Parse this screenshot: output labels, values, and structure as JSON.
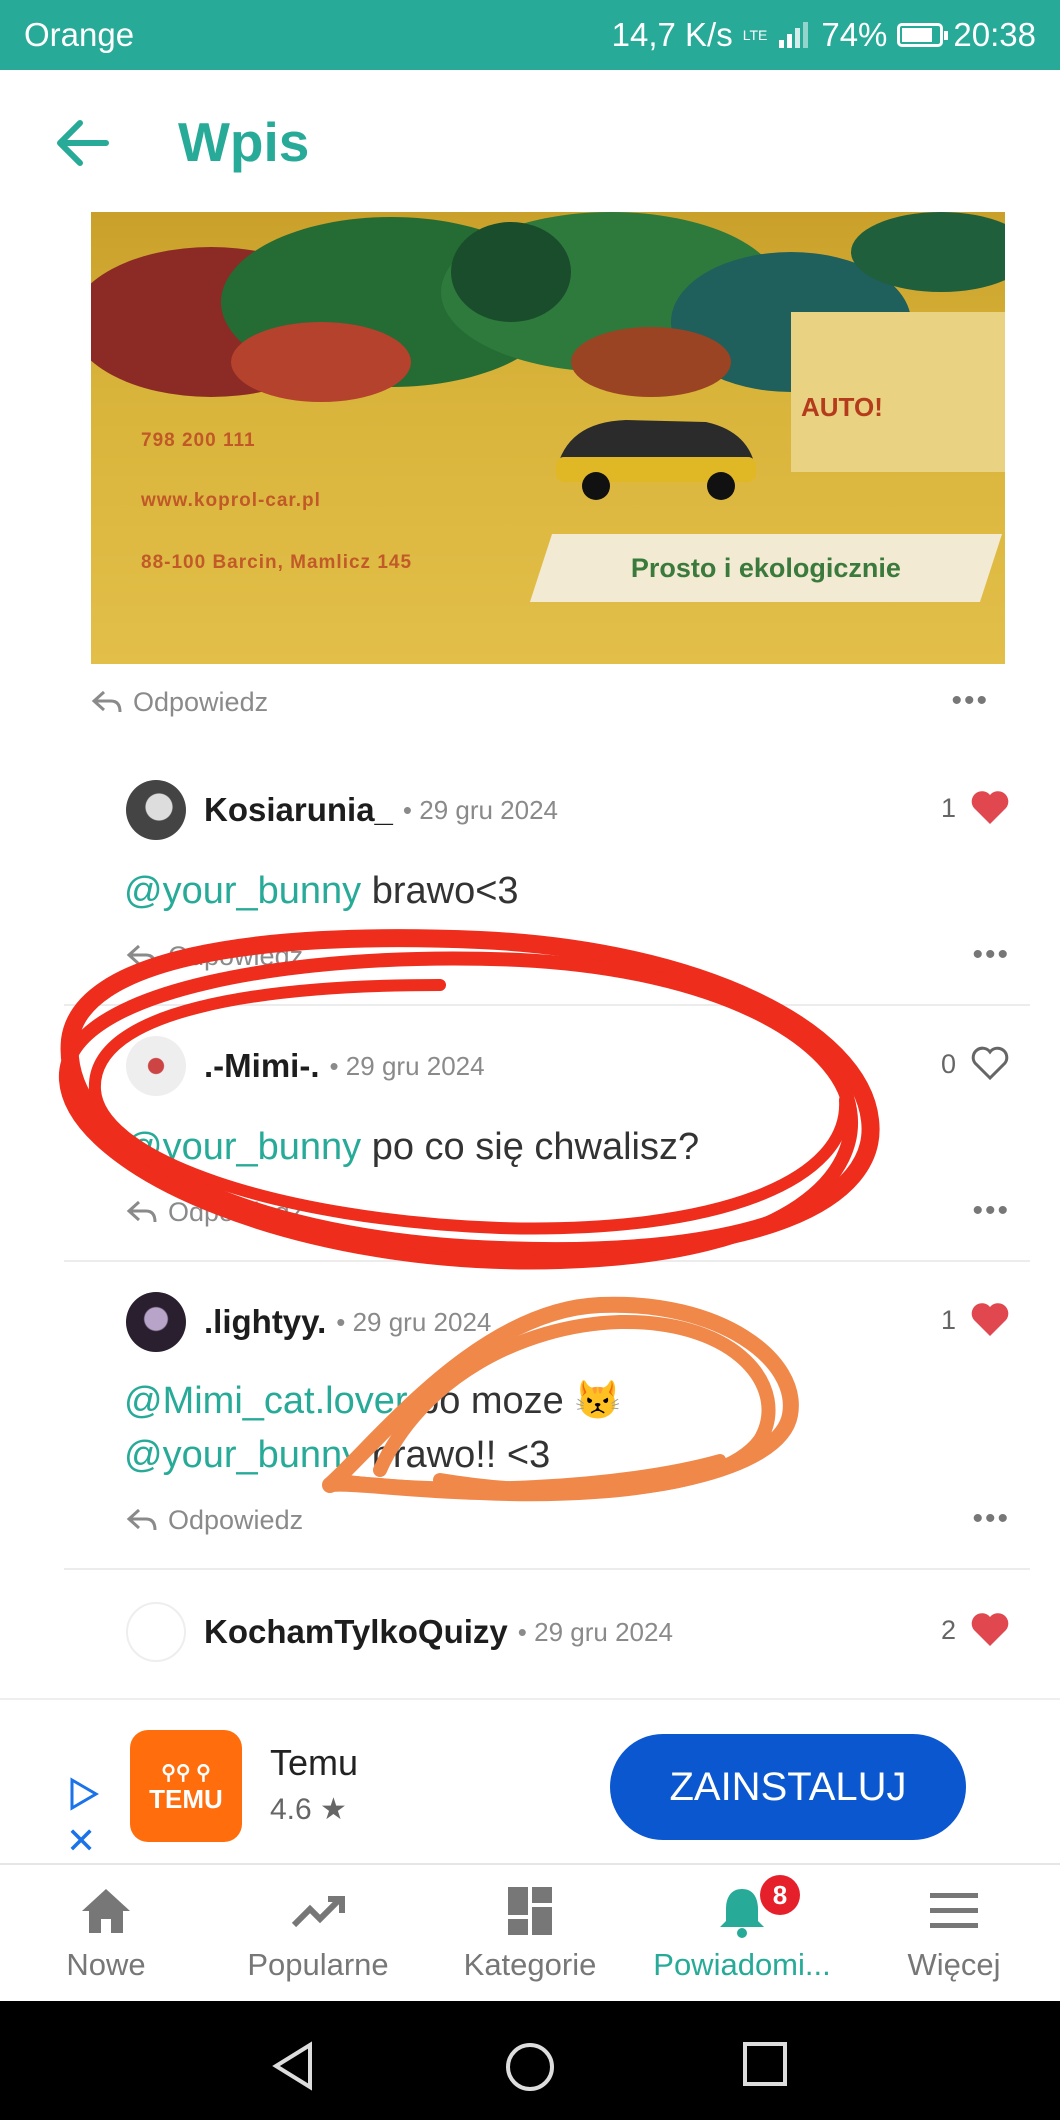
{
  "status_bar": {
    "carrier": "Orange",
    "speed": "14,7 K/s",
    "network": "LTE",
    "battery": "74%",
    "time": "20:38"
  },
  "header": {
    "title": "Wpis"
  },
  "photo": {
    "phone": "798 200 111",
    "website": "www.koprol-car.pl",
    "address": "88-100 Barcin, Mamlicz 145",
    "slogan": "Prosto i ekologicznie",
    "poster_text": "AUTO!"
  },
  "post_actions": {
    "reply_label": "Odpowiedz",
    "more": "•••"
  },
  "comments": [
    {
      "user": "Kosiarunia_",
      "date": "• 29 gru 2024",
      "likes": "1",
      "liked": true,
      "mention": "@your_bunny",
      "text": " brawo<3",
      "reply_label": "Odpowiedz",
      "more": "•••"
    },
    {
      "user": ".-Mimi-.",
      "date": "• 29 gru 2024",
      "likes": "0",
      "liked": false,
      "mention": "@your_bunny",
      "text": " po co się chwalisz?",
      "reply_label": "Odpowiedz",
      "more": "•••"
    },
    {
      "user": ".lightyy.",
      "date": "• 29 gru 2024",
      "likes": "1",
      "liked": true,
      "mention": "@Mimi_cat.lover",
      "text": " bo moze 😾",
      "mention2": "@your_bunny",
      "text2": " brawo!! <3",
      "reply_label": "Odpowiedz",
      "more": "•••"
    },
    {
      "user": "KochamTylkoQuizy",
      "date": "• 29 gru 2024",
      "likes": "2",
      "liked": true
    }
  ],
  "ad": {
    "app_name": "Temu",
    "rating": "4.6 ★",
    "icon_text": "TEMU",
    "install_label": "ZAINSTALUJ",
    "close": "✕"
  },
  "bottom_nav": {
    "items": [
      {
        "label": "Nowe",
        "icon": "home-icon"
      },
      {
        "label": "Popularne",
        "icon": "trending-icon"
      },
      {
        "label": "Kategorie",
        "icon": "grid-icon"
      },
      {
        "label": "Powiadomi...",
        "icon": "bell-icon",
        "badge": "8"
      },
      {
        "label": "Więcej",
        "icon": "menu-icon"
      }
    ]
  },
  "colors": {
    "accent": "#27ab98",
    "like": "#e0474f",
    "install": "#0b57d0",
    "temu": "#ff6d0c"
  }
}
